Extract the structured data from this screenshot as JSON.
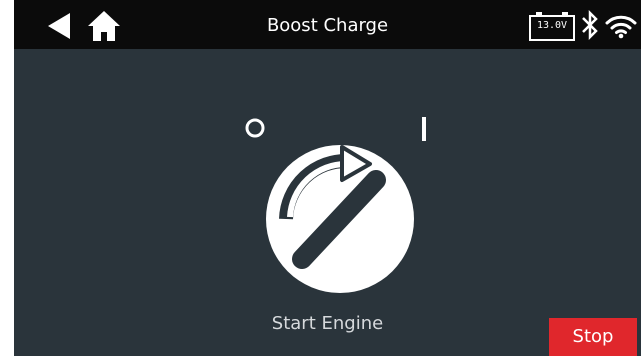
{
  "header": {
    "title": "Boost Charge",
    "back_icon": "back-arrow-icon",
    "home_icon": "home-icon"
  },
  "status": {
    "battery_voltage": "13.0V",
    "bluetooth_icon": "bluetooth-icon",
    "wifi_icon": "wifi-icon"
  },
  "main": {
    "instruction": "Start Engine",
    "ignition_icon": "ignition-key-icon"
  },
  "actions": {
    "stop_label": "Stop"
  },
  "colors": {
    "background": "#2a343b",
    "topbar": "#0b0b0b",
    "stop_button": "#e0272c"
  }
}
